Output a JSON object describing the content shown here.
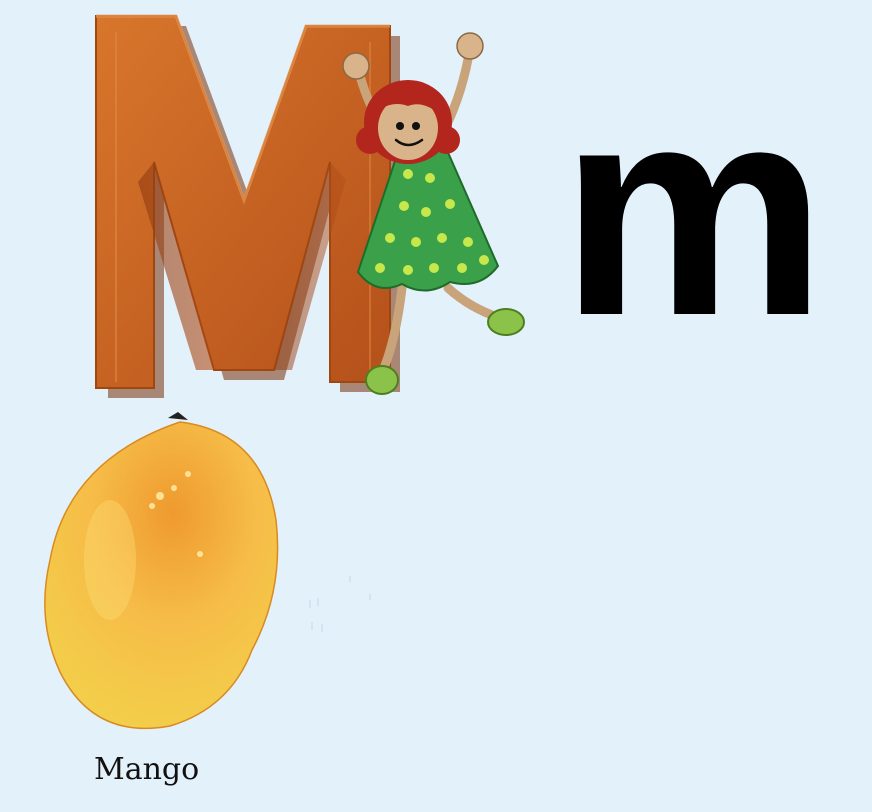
{
  "letter": {
    "uppercase": "M",
    "lowercase": "m"
  },
  "word": {
    "label": "Mango"
  },
  "illustrations": {
    "block_letter": "orange-3d-letter-m",
    "character": "girl-in-green-polka-dot-dress",
    "fruit": "mango"
  },
  "colors": {
    "background": "#e3f1fb",
    "letter_block": "#c9601b",
    "dress": "#3aa04a",
    "hair": "#b3261e",
    "mango": "#f4b43a"
  }
}
